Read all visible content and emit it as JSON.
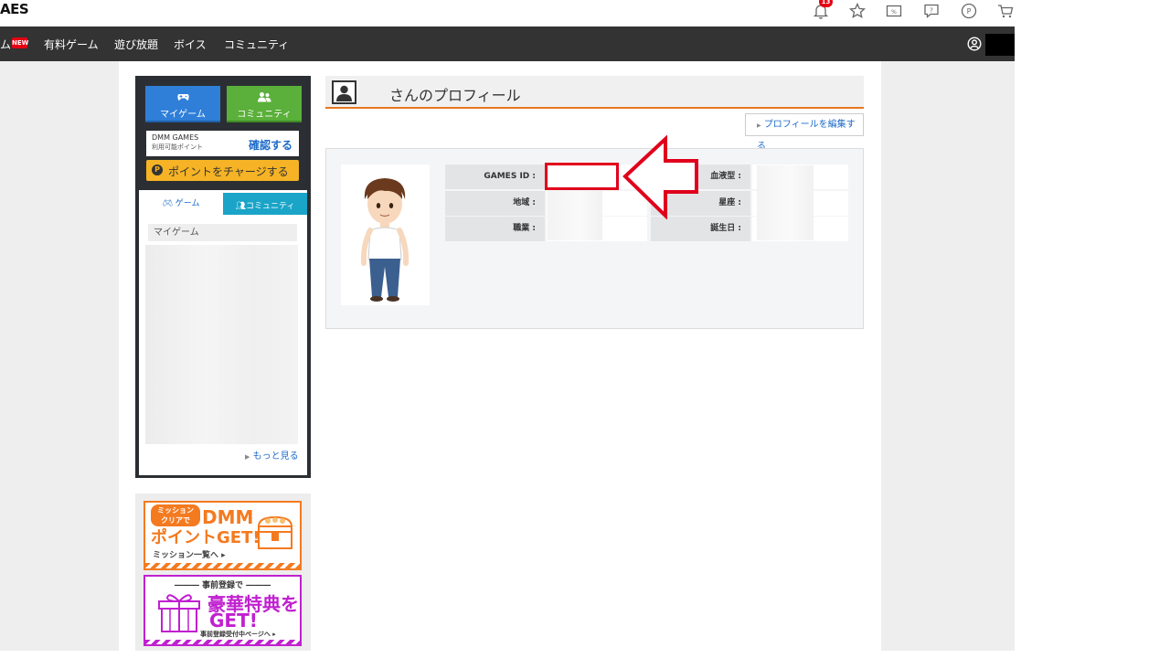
{
  "header": {
    "logo": "AES",
    "notification_count": "13",
    "icons": [
      "bell-icon",
      "star-icon",
      "ticket-icon",
      "help-icon",
      "point-icon",
      "cart-icon"
    ]
  },
  "nav": {
    "items": [
      {
        "label": "ム"
      },
      {
        "label": "有料ゲーム"
      },
      {
        "label": "遊び放題"
      },
      {
        "label": "ボイス"
      },
      {
        "label": "コミュニティ"
      }
    ],
    "new_badge": "NEW"
  },
  "sidebar": {
    "mygame_btn": "マイゲーム",
    "community_btn": "コミュニティ",
    "points_title": "DMM GAMES",
    "points_sub": "利用可能ポイント",
    "points_link": "確認する",
    "charge_btn": "ポイントをチャージする",
    "tab_game": "ゲーム",
    "tab_community": "コミュニティ",
    "mygame_heading": "マイゲーム",
    "more_link": "もっと見る"
  },
  "banners": {
    "b1_tag_line1": "ミッション",
    "b1_tag_line2": "クリアで",
    "b1_big1": "DMM",
    "b1_big2": "ポイントGET!",
    "b1_small": "ミッション一覧へ ▸",
    "b2_top": "――― 事前登録で ―――",
    "b2_big1": "豪華特典を",
    "b2_big2": "GET!",
    "b2_small": "事前登録受付中ページへ ▸"
  },
  "profile": {
    "title": "さんのプロフィール",
    "edit_button": "プロフィールを編集する",
    "fields": {
      "games_id": "GAMES ID :",
      "region": "地域 :",
      "job": "職業 :",
      "blood": "血液型 :",
      "sign": "星座 :",
      "birthday": "誕生日 :"
    }
  },
  "colors": {
    "nav_bg": "#333333",
    "accent_orange": "#e8771e",
    "highlight_red": "#e0001b",
    "mygame_blue": "#2f7fd9",
    "community_green": "#5ab03a"
  }
}
